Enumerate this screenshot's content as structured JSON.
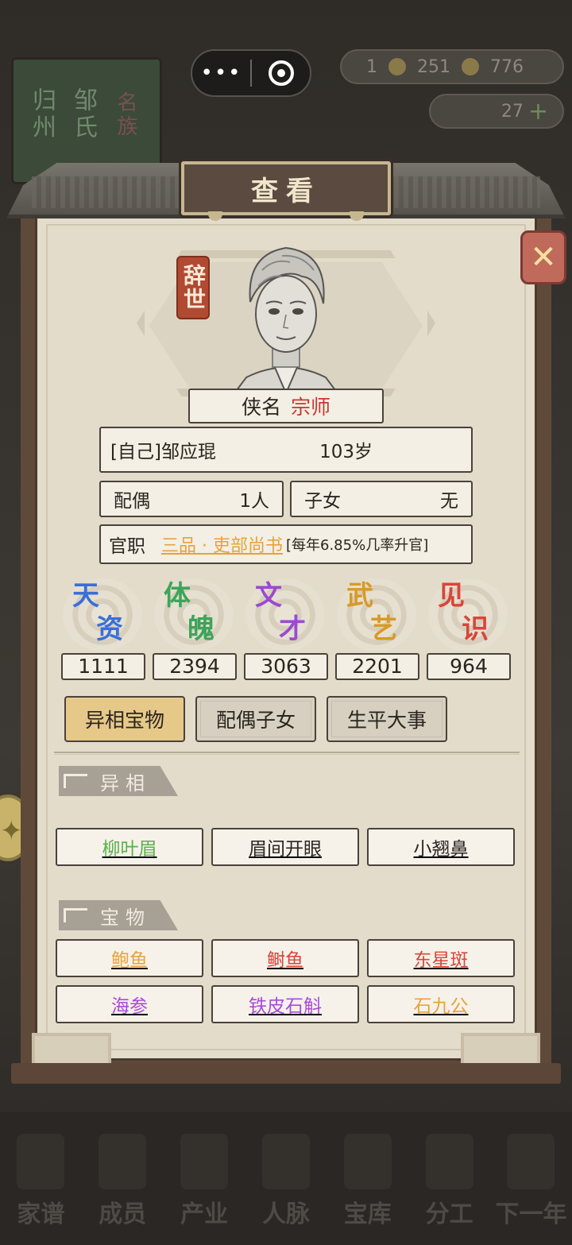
{
  "topbar": {
    "capsule_dots": "•••",
    "resource1_left": "1",
    "resource1_a": "251",
    "resource1_b": "776",
    "resource2": "27"
  },
  "background": {
    "book_text_1": "归州",
    "book_text_2": "邹氏",
    "book_text_3": "名族"
  },
  "panel": {
    "title": "查看",
    "status_stamp": "辞世",
    "close_symbol": "✕"
  },
  "character": {
    "hero_label": "侠名",
    "hero_title": "宗师",
    "name": "[自己]邹应琨",
    "age": "103岁",
    "spouse_label": "配偶",
    "spouse_value": "1人",
    "children_label": "子女",
    "children_value": "无",
    "office_label": "官职",
    "office_title": "三品 · 吏部尚书",
    "office_note": "[每年6.85%几率升官]"
  },
  "stats": [
    {
      "c1": "天",
      "c2": "资",
      "value": "1111",
      "color": "#3a6fd8"
    },
    {
      "c1": "体",
      "c2": "魄",
      "value": "2394",
      "color": "#3da45a"
    },
    {
      "c1": "文",
      "c2": "才",
      "value": "3063",
      "color": "#9a4ad0"
    },
    {
      "c1": "武",
      "c2": "艺",
      "value": "2201",
      "color": "#d89a28"
    },
    {
      "c1": "见",
      "c2": "识",
      "value": "964",
      "color": "#d8463a"
    }
  ],
  "tabs": {
    "treasure": "异相宝物",
    "family": "配偶子女",
    "life": "生平大事"
  },
  "sections": {
    "features_title": "异相",
    "treasures_title": "宝物"
  },
  "features": [
    {
      "label": "柳叶眉",
      "color": "#5ab04a"
    },
    {
      "label": "眉间开眼",
      "color": "#2b2520"
    },
    {
      "label": "小翘鼻",
      "color": "#2b2520"
    }
  ],
  "treasures": [
    {
      "label": "鲍鱼",
      "color": "#e8a23a"
    },
    {
      "label": "鲥鱼",
      "color": "#d8463a"
    },
    {
      "label": "东星斑",
      "color": "#d8463a"
    },
    {
      "label": "海参",
      "color": "#a84ad8"
    },
    {
      "label": "铁皮石斛",
      "color": "#a84ad8"
    },
    {
      "label": "石九公",
      "color": "#e8a23a"
    }
  ],
  "bottom_nav": [
    "家谱",
    "成员",
    "产业",
    "人脉",
    "宝库",
    "分工",
    "下一年"
  ]
}
